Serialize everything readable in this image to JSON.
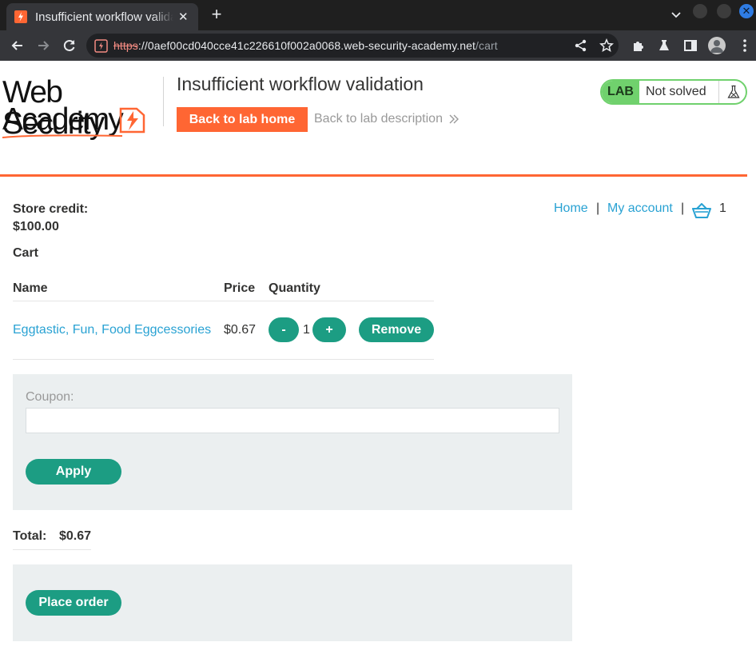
{
  "browser": {
    "tab_title": "Insufficient workflow validation",
    "tab_close": "✕",
    "new_tab": "+",
    "url_scheme": "https",
    "url_sep": "://",
    "url_host": "0aef00cd040cce41c226610f002a0068.web-security-academy.net",
    "url_path": "/cart",
    "close_glyph": "✕"
  },
  "header": {
    "logo_line1": "Web Security",
    "logo_line2": "Academy",
    "lab_title": "Insufficient workflow validation",
    "back_home_label": "Back to lab home",
    "back_description_label": "Back to lab description",
    "lab_badge": "LAB",
    "lab_status": "Not solved"
  },
  "account": {
    "store_credit_label": "Store credit:",
    "store_credit_value": "$100.00"
  },
  "nav": {
    "home": "Home",
    "separator": "|",
    "my_account": "My account",
    "cart_count": "1"
  },
  "cart": {
    "heading": "Cart",
    "columns": {
      "name": "Name",
      "price": "Price",
      "quantity": "Quantity"
    },
    "items": [
      {
        "name": "Eggtastic, Fun, Food Eggcessories",
        "price": "$0.67",
        "quantity": "1",
        "decrement_label": "-",
        "increment_label": "+",
        "remove_label": "Remove"
      }
    ]
  },
  "coupon": {
    "label": "Coupon:",
    "value": "",
    "apply_label": "Apply"
  },
  "totals": {
    "label": "Total:",
    "value": "$0.67"
  },
  "order": {
    "place_order_label": "Place order"
  },
  "colors": {
    "accent_orange": "#ff6633",
    "button_green": "#1c9d83",
    "link_blue": "#29a2d3",
    "lab_green": "#70d16d",
    "panel_grey": "#ebeff0"
  }
}
